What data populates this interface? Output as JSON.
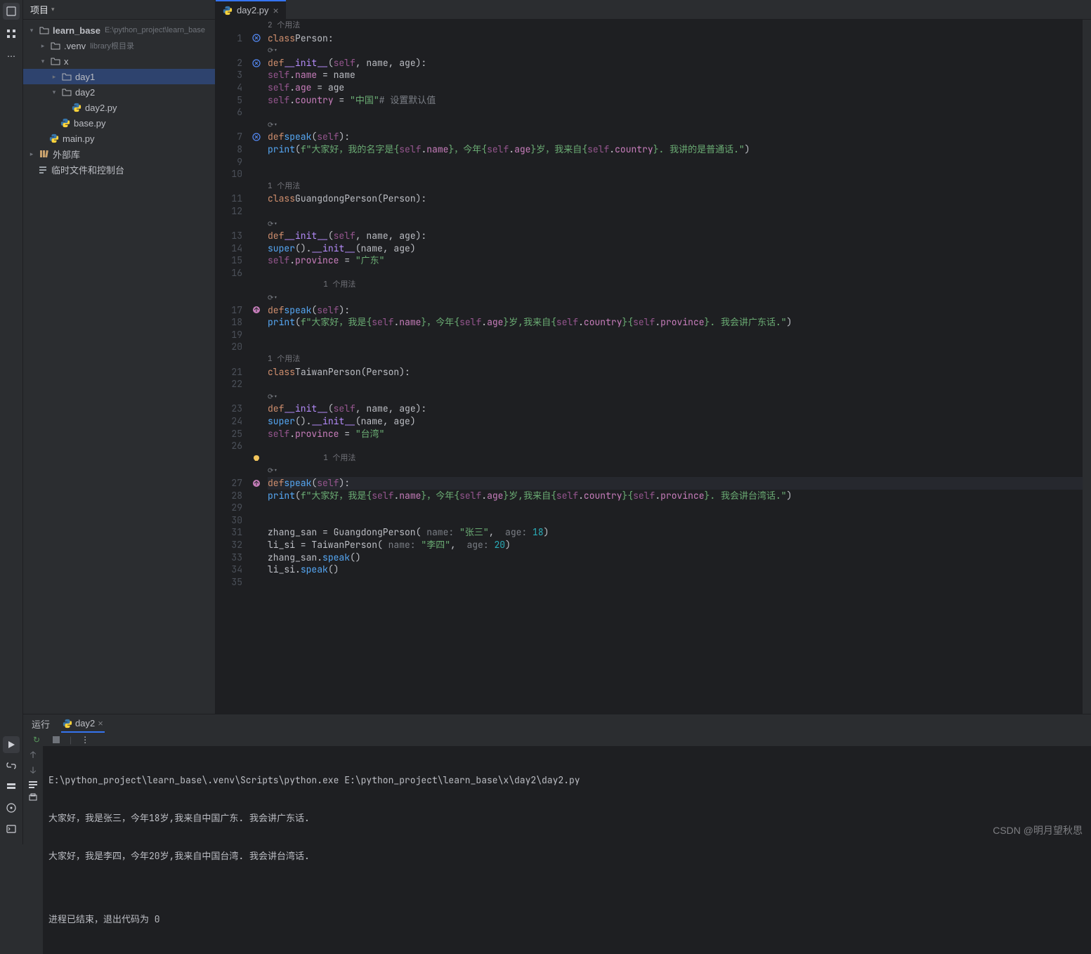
{
  "sidebar": {
    "title": "项目"
  },
  "tree": {
    "root": {
      "name": "learn_base",
      "path": "E:\\python_project\\learn_base"
    },
    "venv": {
      "name": ".venv",
      "hint": "library根目录"
    },
    "x": {
      "name": "x"
    },
    "day1": {
      "name": "day1"
    },
    "day2": {
      "name": "day2"
    },
    "day2py": {
      "name": "day2.py"
    },
    "basepy": {
      "name": "base.py"
    },
    "mainpy": {
      "name": "main.py"
    },
    "extlib": {
      "name": "外部库"
    },
    "scratch": {
      "name": "临时文件和控制台"
    }
  },
  "tab": {
    "name": "day2.py"
  },
  "usages": {
    "two": "2 个用法",
    "one": "1 个用法"
  },
  "run_tab_label": "运行",
  "run_name": "day2",
  "console": {
    "l1": "E:\\python_project\\learn_base\\.venv\\Scripts\\python.exe E:\\python_project\\learn_base\\x\\day2\\day2.py",
    "l2": "大家好，我是张三，今年18岁,我来自中国广东. 我会讲广东话.",
    "l3": "大家好，我是李四，今年20岁,我来自中国台湾. 我会讲台湾话.",
    "l4": "",
    "l5": "进程已结束，退出代码为 0"
  },
  "code": {
    "t_class": "class",
    "t_def": "def",
    "person": "Person",
    "gd": "GuangdongPerson",
    "tw": "TaiwanPerson",
    "init": "__init__",
    "speak": "speak",
    "self": "self",
    "name": "name",
    "age": "age",
    "country": "country",
    "province": "province",
    "super": "super",
    "print": "print",
    "cn": "\"中国\"",
    "cmt": "# 设置默认值",
    "gd_str": "\"广东\"",
    "tw_str": "\"台湾\"",
    "f8": "\"大家好，我的名字是",
    "f8b": "岁，我来自",
    "f8c": ". 我讲的是普通话.\"",
    "f18a": "\"大家好，我是",
    "f18b": "岁,我来自",
    "f18c": ". 我会讲广东话.\"",
    "f28c": ". 我会讲台湾话.\"",
    "f_yr": "，今年",
    "zs": "zhang_san",
    "ls": "li_si",
    "zs_str": "\"张三\"",
    "ls_str": "\"李四\"",
    "n18": "18",
    "n20": "20",
    "hint_name": "name: ",
    "hint_age": "age: "
  },
  "watermark": "CSDN @明月望秋思"
}
